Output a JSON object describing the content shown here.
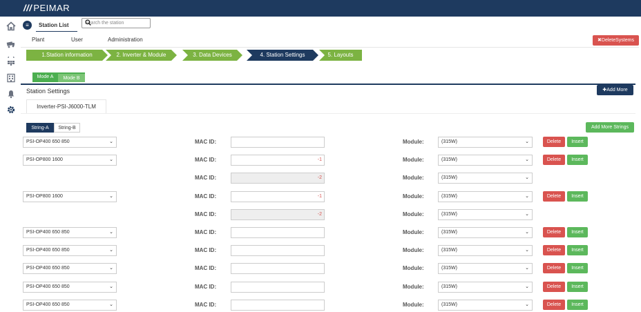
{
  "app": {
    "logo_text": "PEIMAR",
    "logo_slashes": "///"
  },
  "sidebar": {
    "icons": [
      "home-icon",
      "truck-icon",
      "solar-panel-icon",
      "building-icon",
      "bell-icon",
      "gear-icon"
    ]
  },
  "header": {
    "station_list_label": "Station List",
    "search_placeholder": "Search the station"
  },
  "nav": {
    "tabs": [
      "Plant",
      "User",
      "Administration"
    ],
    "delete_systems_label": "✖DeleteSystems"
  },
  "steps": [
    {
      "label": "1.Station information",
      "state": "done"
    },
    {
      "label": "2. Inverter & Module",
      "state": "done"
    },
    {
      "label": "3. Data Devices",
      "state": "done"
    },
    {
      "label": "4. Station Settings",
      "state": "active"
    },
    {
      "label": "5. Layouts",
      "state": "done"
    }
  ],
  "modes": [
    "Mode A",
    "Mode B"
  ],
  "station_settings": {
    "title": "Station Settings",
    "add_more_label": "✚Add More",
    "inverter_tab": "Inverter-PSI-J6000-TLM",
    "string_tabs": [
      "String-A",
      "String-B"
    ],
    "add_more_strings_label": "Add More Strings",
    "mac_label": "MAC ID:",
    "module_label": "Module:",
    "delete_label": "Delete",
    "insert_label": "Insert",
    "rows": [
      {
        "string": "PSI-OP400 650 850",
        "mac": "",
        "mac_disabled": false,
        "module": "(315W)",
        "actions": true
      },
      {
        "string": "PSI-OP800 1600",
        "mac": "-1",
        "mac_disabled": false,
        "module": "(315W)",
        "actions": true
      },
      {
        "string": "",
        "mac": "-2",
        "mac_disabled": true,
        "module": "(315W)",
        "actions": false
      },
      {
        "string": "PSI-OP800 1600",
        "mac": "-1",
        "mac_disabled": false,
        "module": "(315W)",
        "actions": true
      },
      {
        "string": "",
        "mac": "-2",
        "mac_disabled": true,
        "module": "(315W)",
        "actions": false
      },
      {
        "string": "PSI-OP400 650 850",
        "mac": "",
        "mac_disabled": false,
        "module": "(315W)",
        "actions": true
      },
      {
        "string": "PSI-OP400 650 850",
        "mac": "",
        "mac_disabled": false,
        "module": "(315W)",
        "actions": true
      },
      {
        "string": "PSI-OP400 650 850",
        "mac": "",
        "mac_disabled": false,
        "module": "(315W)",
        "actions": true
      },
      {
        "string": "PSI-OP400 650 850",
        "mac": "",
        "mac_disabled": false,
        "module": "(315W)",
        "actions": true
      },
      {
        "string": "PSI-OP400 650 850",
        "mac": "",
        "mac_disabled": false,
        "module": "(315W)",
        "actions": true
      }
    ]
  },
  "colors": {
    "navy": "#1e3a5f",
    "step_green": "#7cb342",
    "mode_green": "#4caf50",
    "danger": "#d9534f",
    "success": "#5cb85c"
  }
}
